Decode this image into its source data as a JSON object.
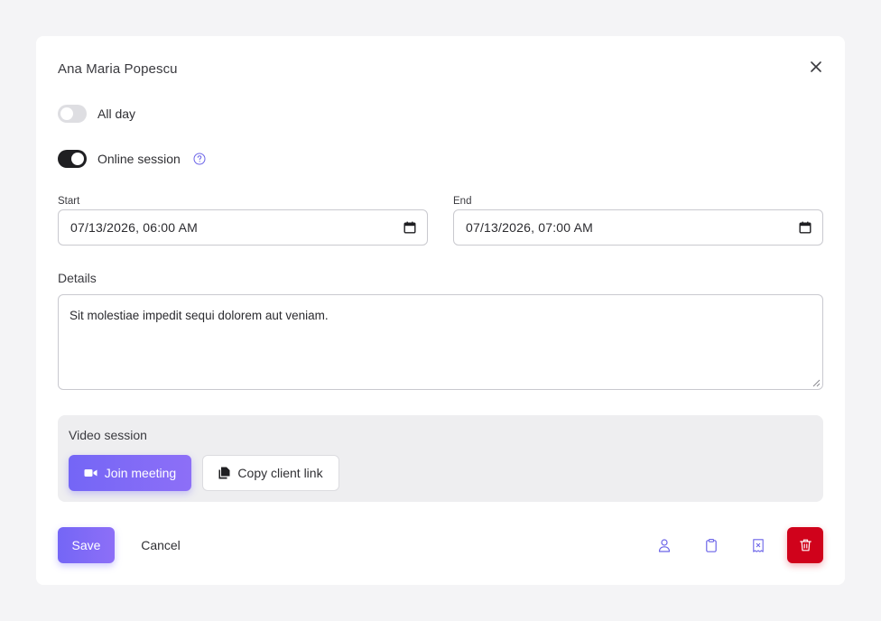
{
  "dialog": {
    "title": "Ana Maria Popescu"
  },
  "toggles": {
    "all_day": {
      "label": "All day",
      "on": false
    },
    "online_session": {
      "label": "Online session",
      "on": true
    }
  },
  "fields": {
    "start": {
      "label": "Start",
      "value": "07/13/2026, 06:00 AM"
    },
    "end": {
      "label": "End",
      "value": "07/13/2026, 07:00 AM"
    },
    "details": {
      "label": "Details",
      "value": "Sit molestiae impedit sequi dolorem aut veniam."
    }
  },
  "video_session": {
    "title": "Video session",
    "join_label": "Join meeting",
    "copy_label": "Copy client link"
  },
  "footer": {
    "save_label": "Save",
    "cancel_label": "Cancel"
  },
  "icons": {
    "close": "close-icon",
    "help": "question-circle-icon",
    "calendar": "calendar-icon",
    "video": "video-camera-icon",
    "copy": "copy-icon",
    "person": "person-icon",
    "clipboard": "clipboard-icon",
    "receipt": "receipt-icon",
    "trash": "trash-icon"
  },
  "colors": {
    "accent": "#7466f6",
    "danger": "#d0021b",
    "toggle_on": "#1f1f22",
    "toggle_off": "#dedee2",
    "panel_bg": "#eeeef0"
  }
}
